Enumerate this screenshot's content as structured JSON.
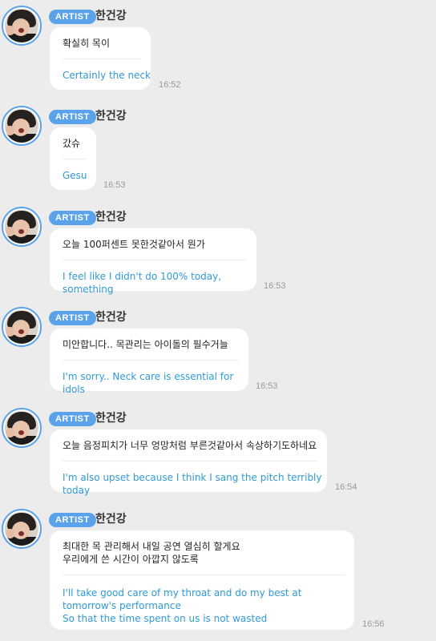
{
  "artist_badge": "ARTIST",
  "messages": [
    {
      "name": "한건강",
      "korean": "확실히 목이",
      "english": "Certainly the neck",
      "time": "16:52"
    },
    {
      "name": "한건강",
      "korean": "갔슈",
      "english": "Gesu",
      "time": "16:53"
    },
    {
      "name": "한건강",
      "korean": "오늘 100퍼센트 못한것같아서 뭔가",
      "english": "I feel like I didn't do 100% today, something",
      "time": "16:53"
    },
    {
      "name": "한건강",
      "korean": "미안합니다.. 목관리는 아이돌의 필수거늘",
      "english": "I'm sorry.. Neck care is essential for idols",
      "time": "16:53"
    },
    {
      "name": "한건강",
      "korean": "오늘 음정피치가 너무 엉망처럼 부른것같아서 속상하기도하네요",
      "english": "I'm also upset because I think I sang the pitch terribly today",
      "time": "16:54"
    },
    {
      "name": "한건강",
      "korean": "최대한 목 관리해서 내일 공연 열심히 할게요\n우리에게 쓴 시간이 아깝지 않도록",
      "english": "I'll take good care of my throat and do my best at tomorrow's performance\nSo that the time spent on us is not wasted",
      "time": "16:56"
    }
  ]
}
